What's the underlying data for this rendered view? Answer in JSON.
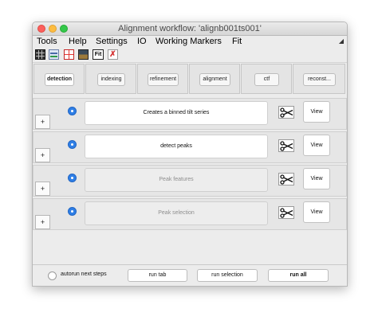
{
  "window": {
    "title": "Alignment workflow: 'alignb001ts001'"
  },
  "menu": [
    "Tools",
    "Help",
    "Settings",
    "IO",
    "Working Markers",
    "Fit"
  ],
  "toolbar": {
    "icons": [
      "grid-view-icon",
      "stack-view-icon",
      "plot-icon",
      "image-icon",
      "fit-icon",
      "markers-icon"
    ],
    "fit_label": "Fit"
  },
  "tabs": [
    {
      "label": "detection",
      "active": true
    },
    {
      "label": "indexing",
      "active": false
    },
    {
      "label": "refinement",
      "active": false
    },
    {
      "label": "alignment",
      "active": false
    },
    {
      "label": "ctf",
      "active": false
    },
    {
      "label": "reconst...",
      "active": false
    }
  ],
  "steps": [
    {
      "label": "Creates a binned tilt series",
      "enabled": true,
      "plus": "+",
      "view": "View"
    },
    {
      "label": "detect peaks",
      "enabled": true,
      "plus": "+",
      "view": "View"
    },
    {
      "label": "Peak features",
      "enabled": false,
      "plus": "+",
      "view": "View"
    },
    {
      "label": "Peak selection",
      "enabled": false,
      "plus": "+",
      "view": "View"
    }
  ],
  "bottom": {
    "autorun_label": "autorun next steps",
    "run_tab": "run tab",
    "run_selection": "run selection",
    "run_all": "run all"
  },
  "colors": {
    "accent": "#2f7fe6",
    "window_bg": "#ececec",
    "step_bg": "#e6e6e6"
  }
}
